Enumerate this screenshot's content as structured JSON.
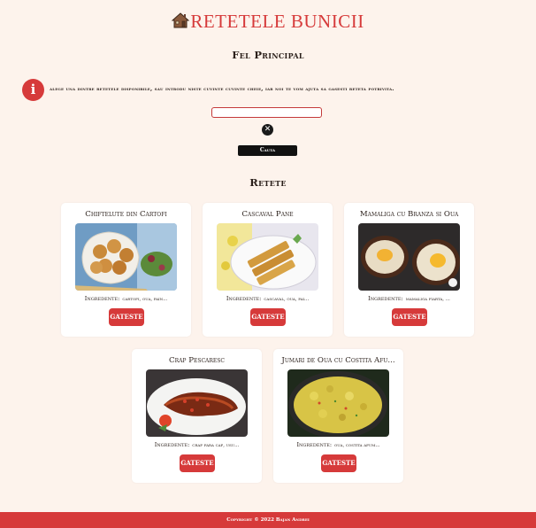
{
  "header": {
    "logo_icon": "house-icon",
    "title": "RETETELE BUNICII"
  },
  "category_title": "Fel Principal",
  "info": {
    "icon": "info-icon",
    "text": "alege una dintre retetele disponibile, sau introdu niste cuvinte cuvinte cheie, iar noi te vom ajuta sa gasesti reteta potrivita."
  },
  "search": {
    "value": "",
    "placeholder": "",
    "clear_icon": "close-icon",
    "button_label": "Cauta"
  },
  "recipes_title": "Retete",
  "recipes": [
    {
      "title": "Chiftelute din Cartofi",
      "ingredients_label": "Ingredente:",
      "ingredients": "cartofi, oua, pain...",
      "button": "GATESTE"
    },
    {
      "title": "Cascaval Pane",
      "ingredients_label": "Ingredente:",
      "ingredients": "cascaval, oua, pai...",
      "button": "GATESTE"
    },
    {
      "title": "Mamaliga cu Branza si Oua",
      "ingredients_label": "Ingredente:",
      "ingredients": "mamaliga fiarta, ...",
      "button": "GATESTE"
    },
    {
      "title": "Crap Pescaresc",
      "ingredients_label": "Ingredente:",
      "ingredients": "crap fara cap, usu...",
      "button": "GATESTE"
    },
    {
      "title": "Jumari de Oua cu Costita Afu...",
      "ingredients_label": "Ingredente:",
      "ingredients": "oua, costita afum...",
      "button": "GATESTE"
    }
  ],
  "footer": {
    "text": "Copyright © 2022 Bajan Andrei"
  },
  "colors": {
    "accent": "#d63a3a",
    "background": "#fdf3ec",
    "card": "#ffffff",
    "dark": "#111111"
  }
}
